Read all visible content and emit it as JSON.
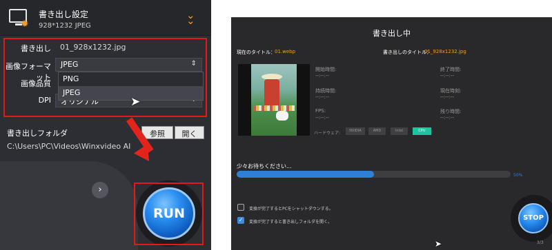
{
  "left_panel": {
    "header": {
      "title": "書き出し設定",
      "subtitle": "928*1232  JPEG",
      "icon": "monitor-gear-icon",
      "collapse_icon": "double-chevron-down-icon"
    },
    "settings": {
      "export_label": "書き出し",
      "export_value": "01_928x1232.jpg",
      "format_label": "画像フォーマット",
      "format_value": "JPEG",
      "quality_label": "画像品質",
      "dpi_label": "DPI",
      "dpi_value": "オリジナル",
      "dropdown_options": [
        "PNG",
        "JPEG"
      ],
      "selected_option": "JPEG"
    },
    "output": {
      "folder_label": "書き出しフォルダ",
      "browse_label": "参照",
      "open_label": "開く",
      "path": "C:\\Users\\PC\\Videos\\Winxvideo AI"
    },
    "run_label": "RUN",
    "accent_color": "#e21a1a"
  },
  "right_panel": {
    "title": "書き出し中",
    "current_title_label": "現在のタイトル：",
    "current_title_value": "01.webp",
    "output_title_label": "書き出しのタイトル：",
    "output_title_value": "01_928x1232.jpg",
    "stats": {
      "start_time_label": "開始時間:",
      "start_time_value": "--:--:--",
      "end_time_label": "終了時間:",
      "end_time_value": "--:--:--",
      "duration_label": "持続時間:",
      "duration_value": "--:--:--",
      "current_time_label": "現在時刻:",
      "current_time_value": "--:--:--",
      "fps_label": "FPS:",
      "fps_value": "--:--:--",
      "remaining_label": "残り時間:",
      "remaining_value": "--:--:--"
    },
    "hardware": {
      "label": "ハードウェア:",
      "chips": [
        "NVIDIA",
        "AMD",
        "Intel",
        "CPU"
      ],
      "active": "CPU"
    },
    "progress": {
      "wait_text": "少々お待ちください...",
      "percent_text": "50%",
      "value": 0.5
    },
    "options": [
      {
        "label": "変換が完了するとPCをシャットダウンする。",
        "checked": false
      },
      {
        "label": "変換が完了すると書き出しフォルダを開く。",
        "checked": true
      }
    ],
    "stop_label": "STOP",
    "page_indicator": "3/3"
  }
}
